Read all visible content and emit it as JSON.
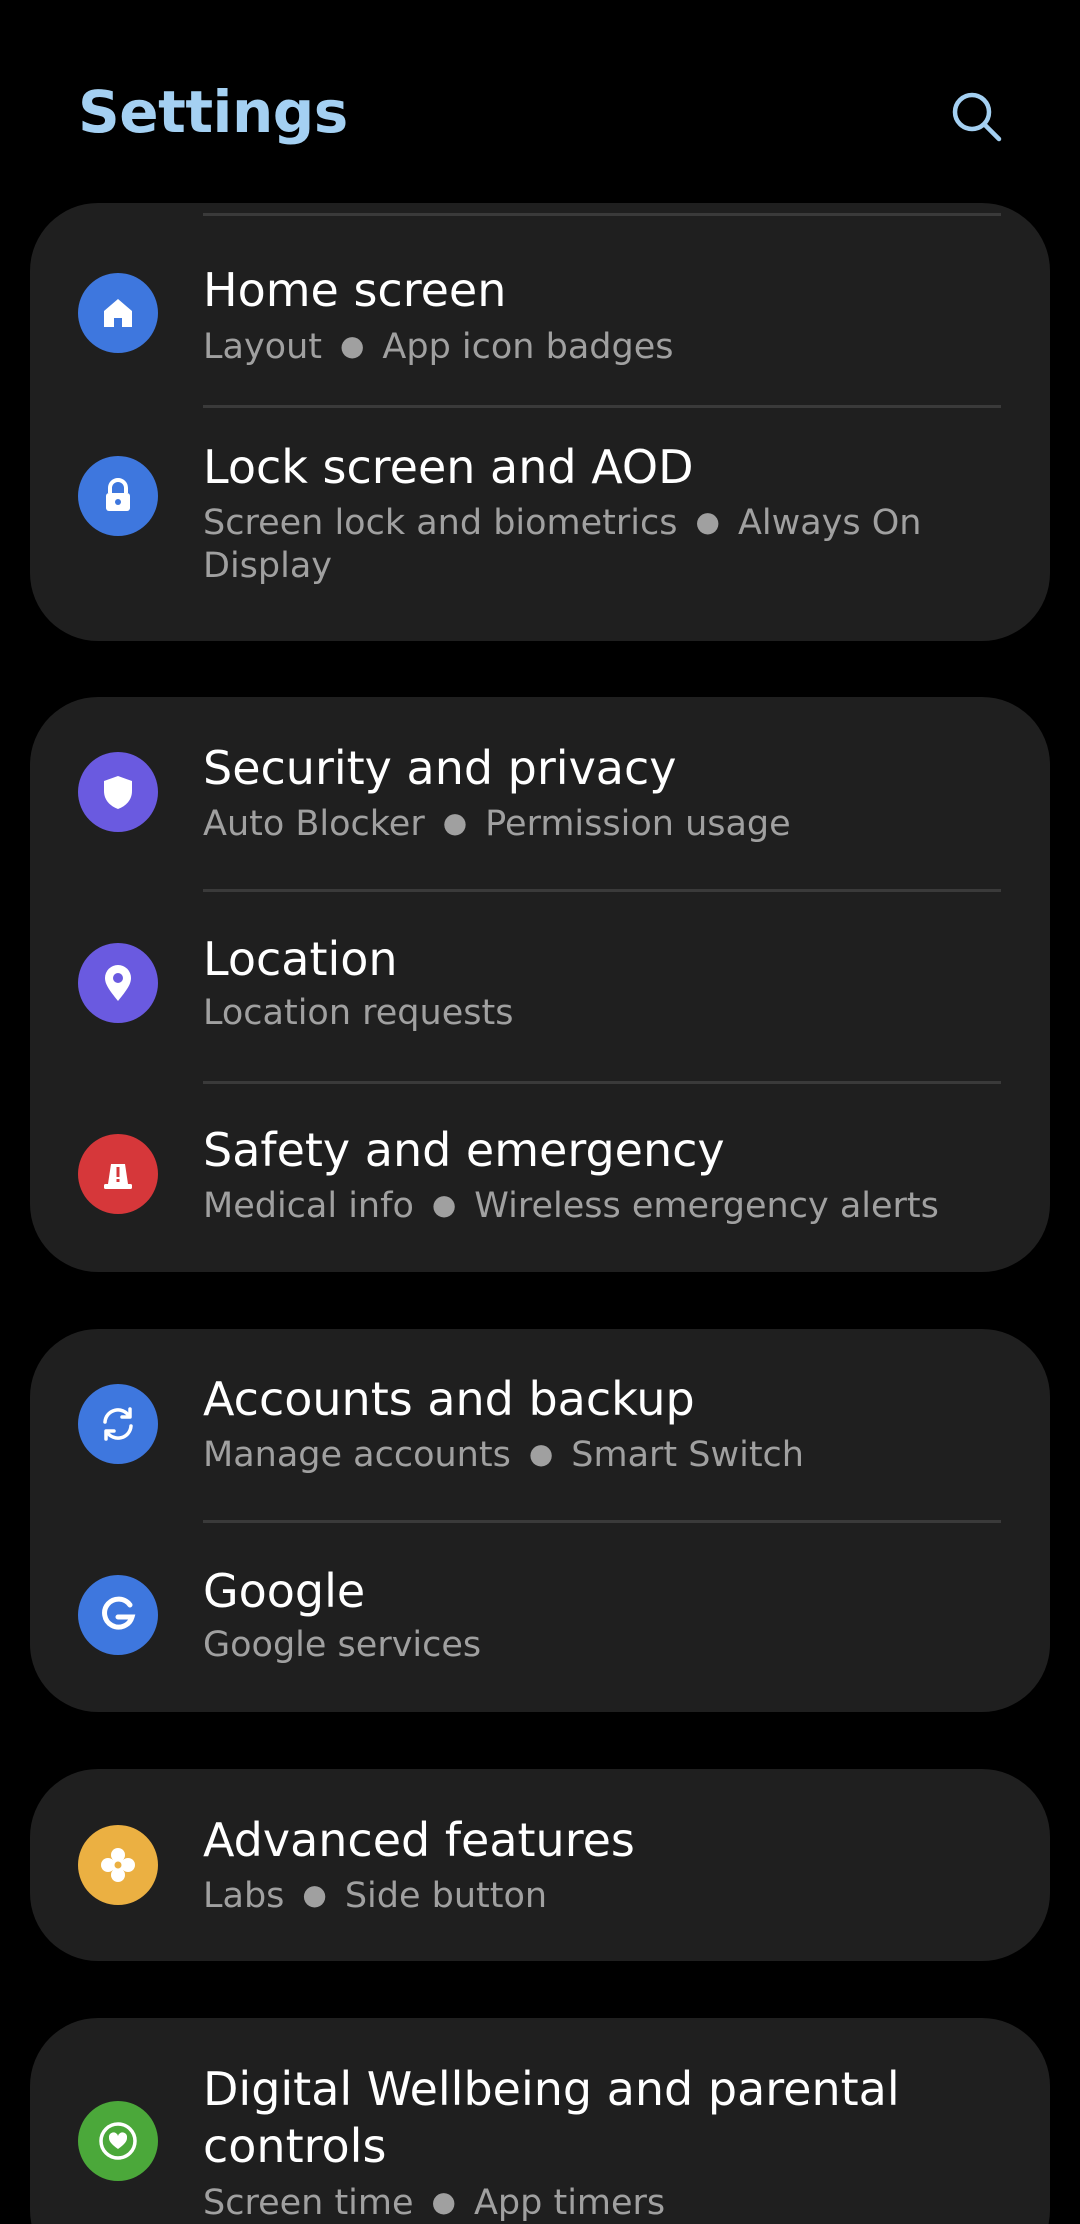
{
  "header": {
    "title": "Settings",
    "search_icon": "search-icon"
  },
  "colors": {
    "background": "#000000",
    "card": "#1f1f1f",
    "title_accent": "#a4d0f2",
    "subtitle": "#a0a0a0",
    "divider": "#3a3a3a"
  },
  "groups": [
    {
      "items": [
        {
          "title": "Home screen",
          "sub": [
            "Layout",
            "App icon badges"
          ],
          "icon": "home-icon",
          "color": "#3e77de"
        },
        {
          "title": "Lock screen and AOD",
          "sub": [
            "Screen lock and biometrics",
            "Always On Display"
          ],
          "icon": "lock-icon",
          "color": "#3e77de"
        }
      ]
    },
    {
      "items": [
        {
          "title": "Security and privacy",
          "sub": [
            "Auto Blocker",
            "Permission usage"
          ],
          "icon": "shield-icon",
          "color": "#6a5ae0"
        },
        {
          "title": "Location",
          "sub": [
            "Location requests"
          ],
          "icon": "location-pin-icon",
          "color": "#6a5ae0"
        },
        {
          "title": "Safety and emergency",
          "sub": [
            "Medical info",
            "Wireless emergency alerts"
          ],
          "icon": "emergency-beacon-icon",
          "color": "#d6373a"
        }
      ]
    },
    {
      "items": [
        {
          "title": "Accounts and backup",
          "sub": [
            "Manage accounts",
            "Smart Switch"
          ],
          "icon": "sync-icon",
          "color": "#3e77de"
        },
        {
          "title": "Google",
          "sub": [
            "Google services"
          ],
          "icon": "google-icon",
          "color": "#3e77de"
        }
      ]
    },
    {
      "items": [
        {
          "title": "Advanced features",
          "sub": [
            "Labs",
            "Side button"
          ],
          "icon": "puzzle-gear-icon",
          "color": "#ebb042"
        }
      ]
    },
    {
      "items": [
        {
          "title": "Digital Wellbeing and parental controls",
          "sub": [
            "Screen time",
            "App timers"
          ],
          "icon": "heart-ring-icon",
          "color": "#4ba83a"
        }
      ]
    }
  ]
}
